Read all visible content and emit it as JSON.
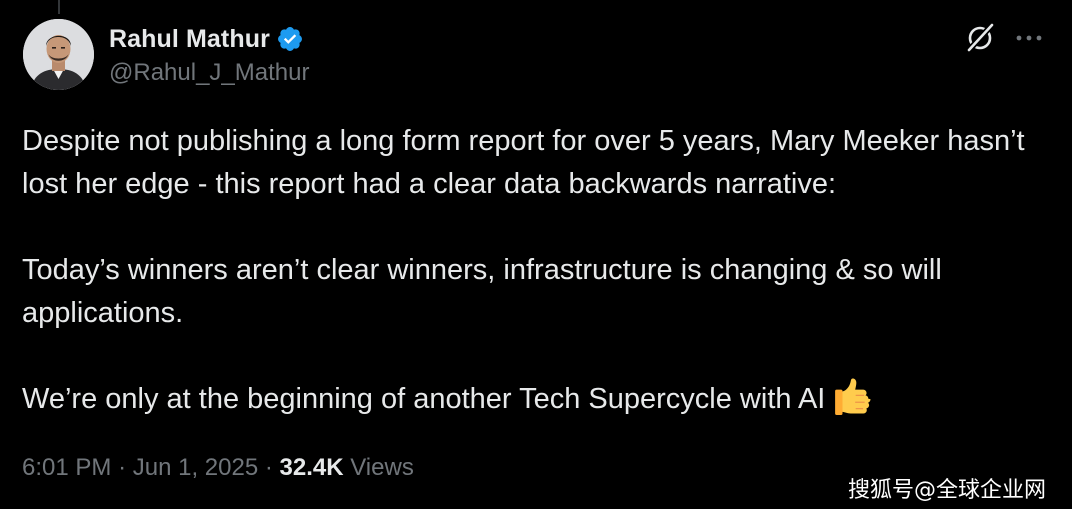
{
  "author": {
    "display_name": "Rahul Mathur",
    "handle": "@Rahul_J_Mathur",
    "verified": true,
    "avatar_icon": "avatar-photo"
  },
  "actions": {
    "grok_icon": "grok-icon",
    "more_icon": "more-options-icon"
  },
  "tweet": {
    "paragraphs": [
      "Despite not publishing a long form report for over 5 years, Mary Meeker hasn’t lost her edge - this report had a clear data backwards narrative:",
      "Today’s winners aren’t clear winners, infrastructure is changing & so will applications.",
      "We’re only at the beginning of another Tech Supercycle with AI"
    ],
    "emoji": "thumbs-up-icon"
  },
  "meta": {
    "time": "6:01 PM",
    "separator": "·",
    "date": "Jun 1, 2025",
    "views_count": "32.4K",
    "views_label": "Views"
  },
  "watermark": "搜狐号@全球企业网",
  "colors": {
    "background": "#000000",
    "text_primary": "#e7e9ea",
    "text_secondary": "#71767b",
    "verified_blue": "#1d9bf0"
  }
}
